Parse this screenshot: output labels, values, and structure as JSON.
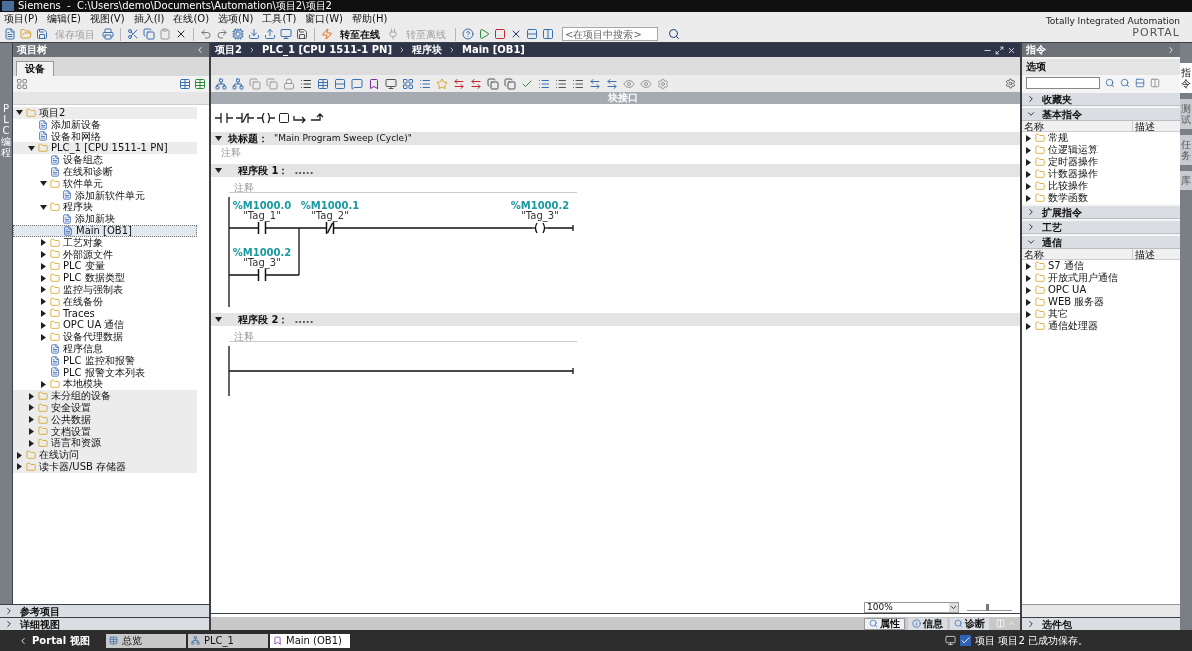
{
  "window": {
    "title": "Siemens  -  C:\\Users\\demo\\Documents\\Automation\\项目2\\项目2"
  },
  "menu": [
    "项目(P)",
    "编辑(E)",
    "视图(V)",
    "插入(I)",
    "在线(O)",
    "选项(N)",
    "工具(T)",
    "窗口(W)",
    "帮助(H)"
  ],
  "brand": {
    "line1": "Totally Integrated Automation",
    "line2": "PORTAL"
  },
  "toolbar": {
    "buttons": [
      {
        "label": "保存项目",
        "disabled": true
      },
      {
        "label": "转至在线",
        "disabled": false
      },
      {
        "label": "转至离线",
        "disabled": true
      }
    ],
    "search_placeholder": "<在项目中搜索>"
  },
  "left_strip": {
    "label": "PLC 编程"
  },
  "project_tree": {
    "title": "项目树",
    "tab": "设备",
    "items": [
      {
        "label": "项目2",
        "expanded": true,
        "selected": false,
        "children": [
          {
            "label": "添加新设备",
            "selected": false
          },
          {
            "label": "设备和网络",
            "selected": false
          },
          {
            "label": "PLC_1 [CPU 1511-1 PN]",
            "expanded": true,
            "selected": false,
            "children": [
              {
                "label": "设备组态",
                "selected": false
              },
              {
                "label": "在线和诊断",
                "selected": false
              },
              {
                "label": "软件单元",
                "expanded": true,
                "selected": false,
                "children": [
                  {
                    "label": "添加新软件单元",
                    "selected": false
                  }
                ]
              },
              {
                "label": "程序块",
                "expanded": true,
                "selected": false,
                "children": [
                  {
                    "label": "添加新块",
                    "selected": false
                  },
                  {
                    "label": "Main [OB1]",
                    "selected": true
                  }
                ]
              },
              {
                "label": "工艺对象",
                "expanded": false,
                "selected": false
              },
              {
                "label": "外部源文件",
                "expanded": false,
                "selected": false
              },
              {
                "label": "PLC 变量",
                "expanded": false,
                "selected": false
              },
              {
                "label": "PLC 数据类型",
                "expanded": false,
                "selected": false
              },
              {
                "label": "监控与强制表",
                "expanded": false,
                "selected": false
              },
              {
                "label": "在线备份",
                "expanded": false,
                "selected": false
              },
              {
                "label": "Traces",
                "expanded": false,
                "selected": false
              },
              {
                "label": "OPC UA 通信",
                "expanded": false,
                "selected": false
              },
              {
                "label": "设备代理数据",
                "expanded": false,
                "selected": false
              },
              {
                "label": "程序信息",
                "selected": false
              },
              {
                "label": "PLC 监控和报警",
                "selected": false
              },
              {
                "label": "PLC 报警文本列表",
                "selected": false
              },
              {
                "label": "本地模块",
                "expanded": false,
                "selected": false
              }
            ]
          },
          {
            "label": "未分组的设备",
            "expanded": false,
            "selected": false
          },
          {
            "label": "安全设置",
            "expanded": false,
            "selected": false
          },
          {
            "label": "公共数据",
            "expanded": false,
            "selected": false
          },
          {
            "label": "文档设置",
            "expanded": false,
            "selected": false
          },
          {
            "label": "语言和资源",
            "expanded": false,
            "selected": false
          }
        ]
      },
      {
        "label": "在线访问",
        "expanded": false,
        "selected": false
      },
      {
        "label": "读卡器/USB 存储器",
        "expanded": false,
        "selected": false
      }
    ]
  },
  "editor": {
    "breadcrumb": [
      "项目2",
      "PLC_1 [CPU 1511-1 PN]",
      "程序块",
      "Main [OB1]"
    ],
    "interface_label": "块接口",
    "block_title_label": "块标题：",
    "block_title": "\"Main Program Sweep (Cycle)\"",
    "block_comment": "注释",
    "networks": [
      {
        "title": "程序段 1：",
        "dots": ".....",
        "comment": "注释",
        "rung": [
          {
            "kind": "contact_no",
            "address": "%M1000.0",
            "tag": "\"Tag_1\""
          },
          {
            "kind": "contact_nc",
            "address": "%M1000.1",
            "tag": "\"Tag_2\""
          },
          {
            "kind": "coil",
            "address": "%M1000.2",
            "tag": "\"Tag_3\""
          }
        ],
        "branch": [
          {
            "kind": "contact_no",
            "address": "%M1000.2",
            "tag": "\"Tag_3\""
          }
        ]
      },
      {
        "title": "程序段 2：",
        "dots": ".....",
        "comment": "注释"
      }
    ],
    "zoom": "100%",
    "zoom_slider": {
      "level": 0.45
    }
  },
  "instructions": {
    "title": "指令",
    "options_label": "选项",
    "sections": [
      {
        "title": "收藏夹",
        "expanded": false
      },
      {
        "title": "基本指令",
        "expanded": true,
        "columns": [
          "名称",
          "描述"
        ],
        "items": [
          "常规",
          "位逻辑运算",
          "定时器操作",
          "计数器操作",
          "比较操作",
          "数学函数"
        ]
      },
      {
        "title": "扩展指令",
        "expanded": false
      },
      {
        "title": "工艺",
        "expanded": false
      },
      {
        "title": "通信",
        "expanded": true,
        "columns": [
          "名称",
          "描述"
        ],
        "items": [
          "S7 通信",
          "开放式用户通信",
          "OPC UA",
          "WEB 服务器",
          "其它",
          "通信处理器"
        ]
      }
    ]
  },
  "side_tabs": [
    {
      "label": "指令",
      "selected": true
    },
    {
      "label": "测试",
      "selected": false
    },
    {
      "label": "任务",
      "selected": false
    },
    {
      "label": "库",
      "selected": false
    }
  ],
  "bottom": {
    "left_sections": [
      "参考项目",
      "详细视图"
    ],
    "inspector_tabs": [
      {
        "label": "属性",
        "selected": true
      },
      {
        "label": "信息",
        "selected": false
      },
      {
        "label": "诊断",
        "selected": false
      }
    ],
    "right_section": "选件包"
  },
  "taskbar": {
    "portal_label": "Portal 视图",
    "tabs": [
      {
        "label": "总览",
        "selected": false
      },
      {
        "label": "PLC_1",
        "selected": false
      },
      {
        "label": "Main (OB1)",
        "selected": true
      }
    ],
    "status": "项目 项目2 已成功保存。"
  }
}
